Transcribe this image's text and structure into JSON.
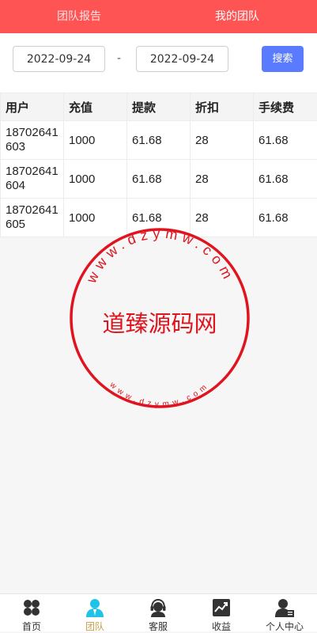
{
  "header": {
    "tabs": [
      {
        "label": "团队报告",
        "active": false
      },
      {
        "label": "我的团队",
        "active": true
      }
    ],
    "background_color": "#ff5454"
  },
  "filter": {
    "start_date": "2022-09-24",
    "separator": "-",
    "end_date": "2022-09-24",
    "search_label": "搜索",
    "search_color": "#5a7bff"
  },
  "table": {
    "columns": [
      "用户",
      "充值",
      "提款",
      "折扣",
      "手续费"
    ],
    "rows": [
      {
        "user": "18702641603",
        "recharge": "1000",
        "withdraw": "61.68",
        "discount": "28",
        "fee": "61.68"
      },
      {
        "user": "18702641604",
        "recharge": "1000",
        "withdraw": "61.68",
        "discount": "28",
        "fee": "61.68"
      },
      {
        "user": "18702641605",
        "recharge": "1000",
        "withdraw": "61.68",
        "discount": "28",
        "fee": "61.68"
      }
    ]
  },
  "watermark": {
    "outer_text": "www.dzymw.com",
    "center_text": "道臻源码网",
    "inner_text": "www.dzymw.com",
    "color": "#e0141e"
  },
  "bottom_nav": {
    "items": [
      {
        "label": "首页",
        "icon": "home-grid-icon",
        "active": false
      },
      {
        "label": "团队",
        "icon": "team-icon",
        "active": true
      },
      {
        "label": "客服",
        "icon": "customer-service-icon",
        "active": false
      },
      {
        "label": "收益",
        "icon": "earnings-chart-icon",
        "active": false
      },
      {
        "label": "个人中心",
        "icon": "profile-icon",
        "active": false
      }
    ],
    "active_color": "#c8a24a"
  }
}
